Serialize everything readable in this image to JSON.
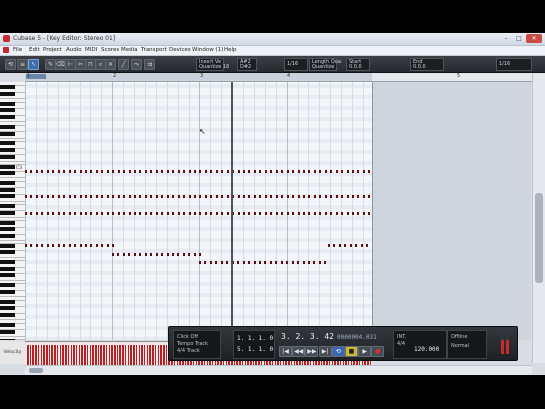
{
  "window": {
    "title": "Cubase 5 - [Key Editor: Stereo 01]",
    "controls": {
      "minimize": "–",
      "maximize": "□",
      "close": "✕"
    }
  },
  "menubar": {
    "items": [
      "File",
      "Edit",
      "Project",
      "Audio",
      "MIDI",
      "Scores",
      "Media",
      "Transport",
      "Devices",
      "Window (1)",
      "Help"
    ]
  },
  "toolbar": {
    "buttons": [
      {
        "icon": "solo-editor-icon",
        "glyph": "⟲"
      },
      {
        "icon": "info-line-icon",
        "glyph": "≡"
      },
      {
        "icon": "object-selection-icon",
        "glyph": "↖"
      },
      {
        "icon": "draw-icon",
        "glyph": "✎"
      },
      {
        "icon": "erase-icon",
        "glyph": "⌫"
      },
      {
        "icon": "trim-icon",
        "glyph": "⊢"
      },
      {
        "icon": "split-icon",
        "glyph": "✂"
      },
      {
        "icon": "glue-icon",
        "glyph": "⊓"
      },
      {
        "icon": "zoom-icon",
        "glyph": "⌕"
      },
      {
        "icon": "mute-icon",
        "glyph": "✕"
      },
      {
        "icon": "line-icon",
        "glyph": "╱"
      },
      {
        "icon": "time-warp-icon",
        "glyph": "⤳"
      },
      {
        "icon": "auto-scroll-icon",
        "glyph": "⇉"
      }
    ],
    "fields": {
      "insert_velocity_top": "Insert Ve",
      "insert_velocity_bottom": "Quantize 16",
      "snap": "1/16",
      "length_top": "Length Qua",
      "length_bottom": "Quantize",
      "quantize": "1/16",
      "position_top": "Start",
      "position_bottom": "0.0.0",
      "end_top": "End",
      "end_bottom": "0.0.0",
      "pitch": "A#2",
      "pitch2": "D#2"
    }
  },
  "ruler": {
    "ticks": [
      "1",
      "2",
      "3",
      "4",
      "5"
    ]
  },
  "keyboard": {
    "c3_label": "C3"
  },
  "velocity_lane": {
    "label": "Velocity"
  },
  "transport": {
    "left_panel": [
      "Click Off",
      "Tempo Track",
      "4/4 Track"
    ],
    "left_locator": "1. 1. 1.   0",
    "right_locator": "5. 1. 1.   0",
    "position_main": "3. 2. 3.  42",
    "position_small": "0:00:04.031",
    "time_secondary": "0000004.031",
    "tempo": "120.000",
    "signature": "4/4",
    "sync": "INT.",
    "offline": "Offline",
    "mode": "Normal"
  }
}
